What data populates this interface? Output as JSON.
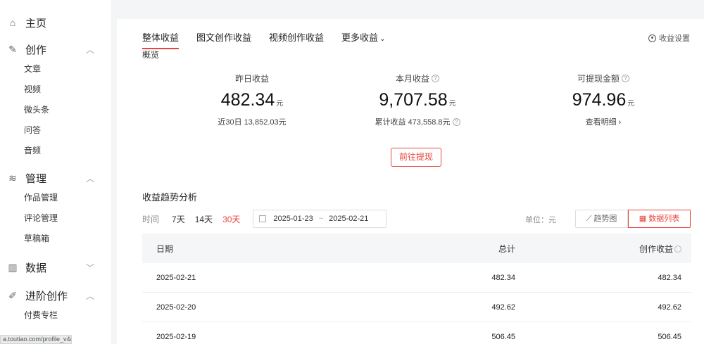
{
  "sidebar": {
    "home": "主页",
    "create": {
      "label": "创作",
      "items": [
        "文章",
        "视频",
        "微头条",
        "问答",
        "音频"
      ]
    },
    "manage": {
      "label": "管理",
      "items": [
        "作品管理",
        "评论管理",
        "草稿箱"
      ]
    },
    "data": {
      "label": "数据"
    },
    "advanced": {
      "label": "进阶创作",
      "items": [
        "付费专栏"
      ]
    }
  },
  "status_url": "a.toutiao.com/profile_v4/",
  "tabs": [
    "整体收益",
    "图文创作收益",
    "视频创作收益",
    "更多收益"
  ],
  "settings_label": "收益设置",
  "overview_label": "概览",
  "stats": {
    "yesterday": {
      "title": "昨日收益",
      "value": "482.34",
      "unit": "元",
      "sub": "近30日 13,852.03元"
    },
    "month": {
      "title": "本月收益",
      "value": "9,707.58",
      "unit": "元",
      "sub": "累计收益 473,558.8元"
    },
    "withdrawable": {
      "title": "可提现金额",
      "value": "974.96",
      "unit": "元",
      "sub": "查看明细 ›"
    }
  },
  "withdraw_button": "前往提现",
  "trend": {
    "title": "收益趋势分析",
    "time_label": "时间",
    "options": [
      "7天",
      "14天",
      "30天"
    ],
    "selected": "30天",
    "date_start": "2025-01-23",
    "date_end": "2025-02-21",
    "unit_label": "单位：元",
    "chart_button": "趋势图",
    "list_button": "数据列表"
  },
  "table": {
    "headers": [
      "日期",
      "总计",
      "创作收益"
    ],
    "rows": [
      [
        "2025-02-21",
        "482.34",
        "482.34"
      ],
      [
        "2025-02-20",
        "492.62",
        "492.62"
      ],
      [
        "2025-02-19",
        "506.45",
        "506.45"
      ]
    ]
  },
  "colors": {
    "accent": "#e8453c"
  }
}
